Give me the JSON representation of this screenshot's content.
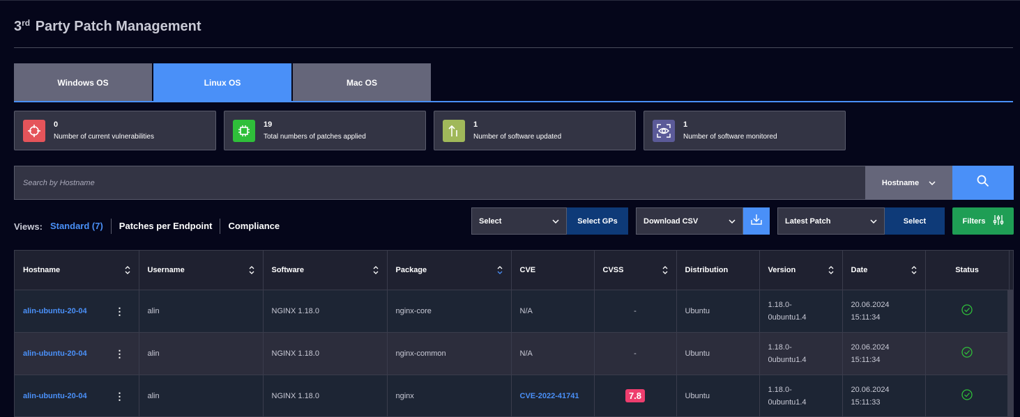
{
  "page": {
    "title_sup": "rd",
    "title_pre": "3",
    "title_rest": "Party Patch Management"
  },
  "tabs": [
    {
      "label": "Windows OS",
      "active": false
    },
    {
      "label": "Linux OS",
      "active": true
    },
    {
      "label": "Mac OS",
      "active": false
    }
  ],
  "stats": [
    {
      "value": "0",
      "label": "Number of current vulnerabilities",
      "icon": "crosshair-icon",
      "color": "#e5545a"
    },
    {
      "value": "19",
      "label": "Total numbers of patches applied",
      "icon": "chip-icon",
      "color": "#2fbf3a"
    },
    {
      "value": "1",
      "label": "Number of software updated",
      "icon": "arrows-up-icon",
      "color": "#a0b85a"
    },
    {
      "value": "1",
      "label": "Number of software monitored",
      "icon": "eye-scan-icon",
      "color": "#5b5a98"
    }
  ],
  "search": {
    "placeholder": "Search by Hostname",
    "field_select": "Hostname"
  },
  "views": {
    "label": "Views:",
    "items": [
      "Standard (7)",
      "Patches per Endpoint",
      "Compliance"
    ]
  },
  "controls": {
    "gp_select": "Select",
    "gp_button": "Select GPs",
    "csv_select": "Download CSV",
    "patch_select": "Latest Patch",
    "patch_button": "Select",
    "filters": "Filters"
  },
  "table": {
    "columns": [
      "Hostname",
      "Username",
      "Software",
      "Package",
      "CVE",
      "CVSS",
      "Distribution",
      "Version",
      "Date",
      "Status"
    ],
    "rows": [
      {
        "hostname": "alin-ubuntu-20-04",
        "username": "alin",
        "software": "NGINX 1.18.0",
        "package": "nginx-core",
        "cve": "N/A",
        "cvss": "-",
        "distribution": "Ubuntu",
        "version_1": "1.18.0-",
        "version_2": "0ubuntu1.4",
        "date_1": "20.06.2024",
        "date_2": "15:11:34",
        "status": "ok"
      },
      {
        "hostname": "alin-ubuntu-20-04",
        "username": "alin",
        "software": "NGINX 1.18.0",
        "package": "nginx-common",
        "cve": "N/A",
        "cvss": "-",
        "distribution": "Ubuntu",
        "version_1": "1.18.0-",
        "version_2": "0ubuntu1.4",
        "date_1": "20.06.2024",
        "date_2": "15:11:34",
        "status": "ok"
      },
      {
        "hostname": "alin-ubuntu-20-04",
        "username": "alin",
        "software": "NGINX 1.18.0",
        "package": "nginx",
        "cve": "CVE-2022-41741",
        "cvss": "7.8",
        "distribution": "Ubuntu",
        "version_1": "1.18.0-",
        "version_2": "0ubuntu1.4",
        "date_1": "20.06.2024",
        "date_2": "15:11:33",
        "status": "ok"
      }
    ]
  }
}
